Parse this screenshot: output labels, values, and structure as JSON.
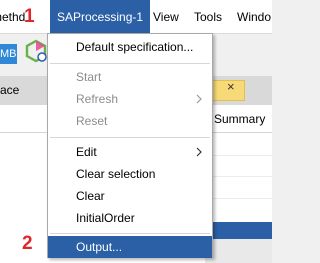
{
  "menubar": {
    "items": [
      {
        "label": "methd",
        "active": false
      },
      {
        "label": "SAProcessing-1",
        "active": true
      },
      {
        "label": "View",
        "active": false
      },
      {
        "label": "Tools",
        "active": false
      },
      {
        "label": "Windo",
        "active": false
      }
    ]
  },
  "toolbar": {
    "button_text": "MB",
    "icon": "gear-app-icon"
  },
  "panel": {
    "label": "ace",
    "tab_close": "×",
    "summary_label": "Summary"
  },
  "annotations": {
    "step1": "1",
    "step2": "2"
  },
  "dropdown": {
    "items": [
      {
        "label": "Default specification...",
        "disabled": false,
        "submenu": false
      },
      {
        "label": "Start",
        "disabled": true,
        "submenu": false
      },
      {
        "label": "Refresh",
        "disabled": true,
        "submenu": true
      },
      {
        "label": "Reset",
        "disabled": true,
        "submenu": false
      },
      {
        "label": "Edit",
        "disabled": false,
        "submenu": true
      },
      {
        "label": "Clear selection",
        "disabled": false,
        "submenu": false
      },
      {
        "label": "Clear",
        "disabled": false,
        "submenu": false
      },
      {
        "label": "InitialOrder",
        "disabled": false,
        "submenu": false
      },
      {
        "label": "Output...",
        "disabled": false,
        "submenu": false,
        "highlighted": true
      }
    ]
  },
  "colors": {
    "accent": "#2b5fa6",
    "badge_red": "#e1262b",
    "tab_yellow": "#f7d977",
    "toolbar_blue": "#2e88d6"
  }
}
